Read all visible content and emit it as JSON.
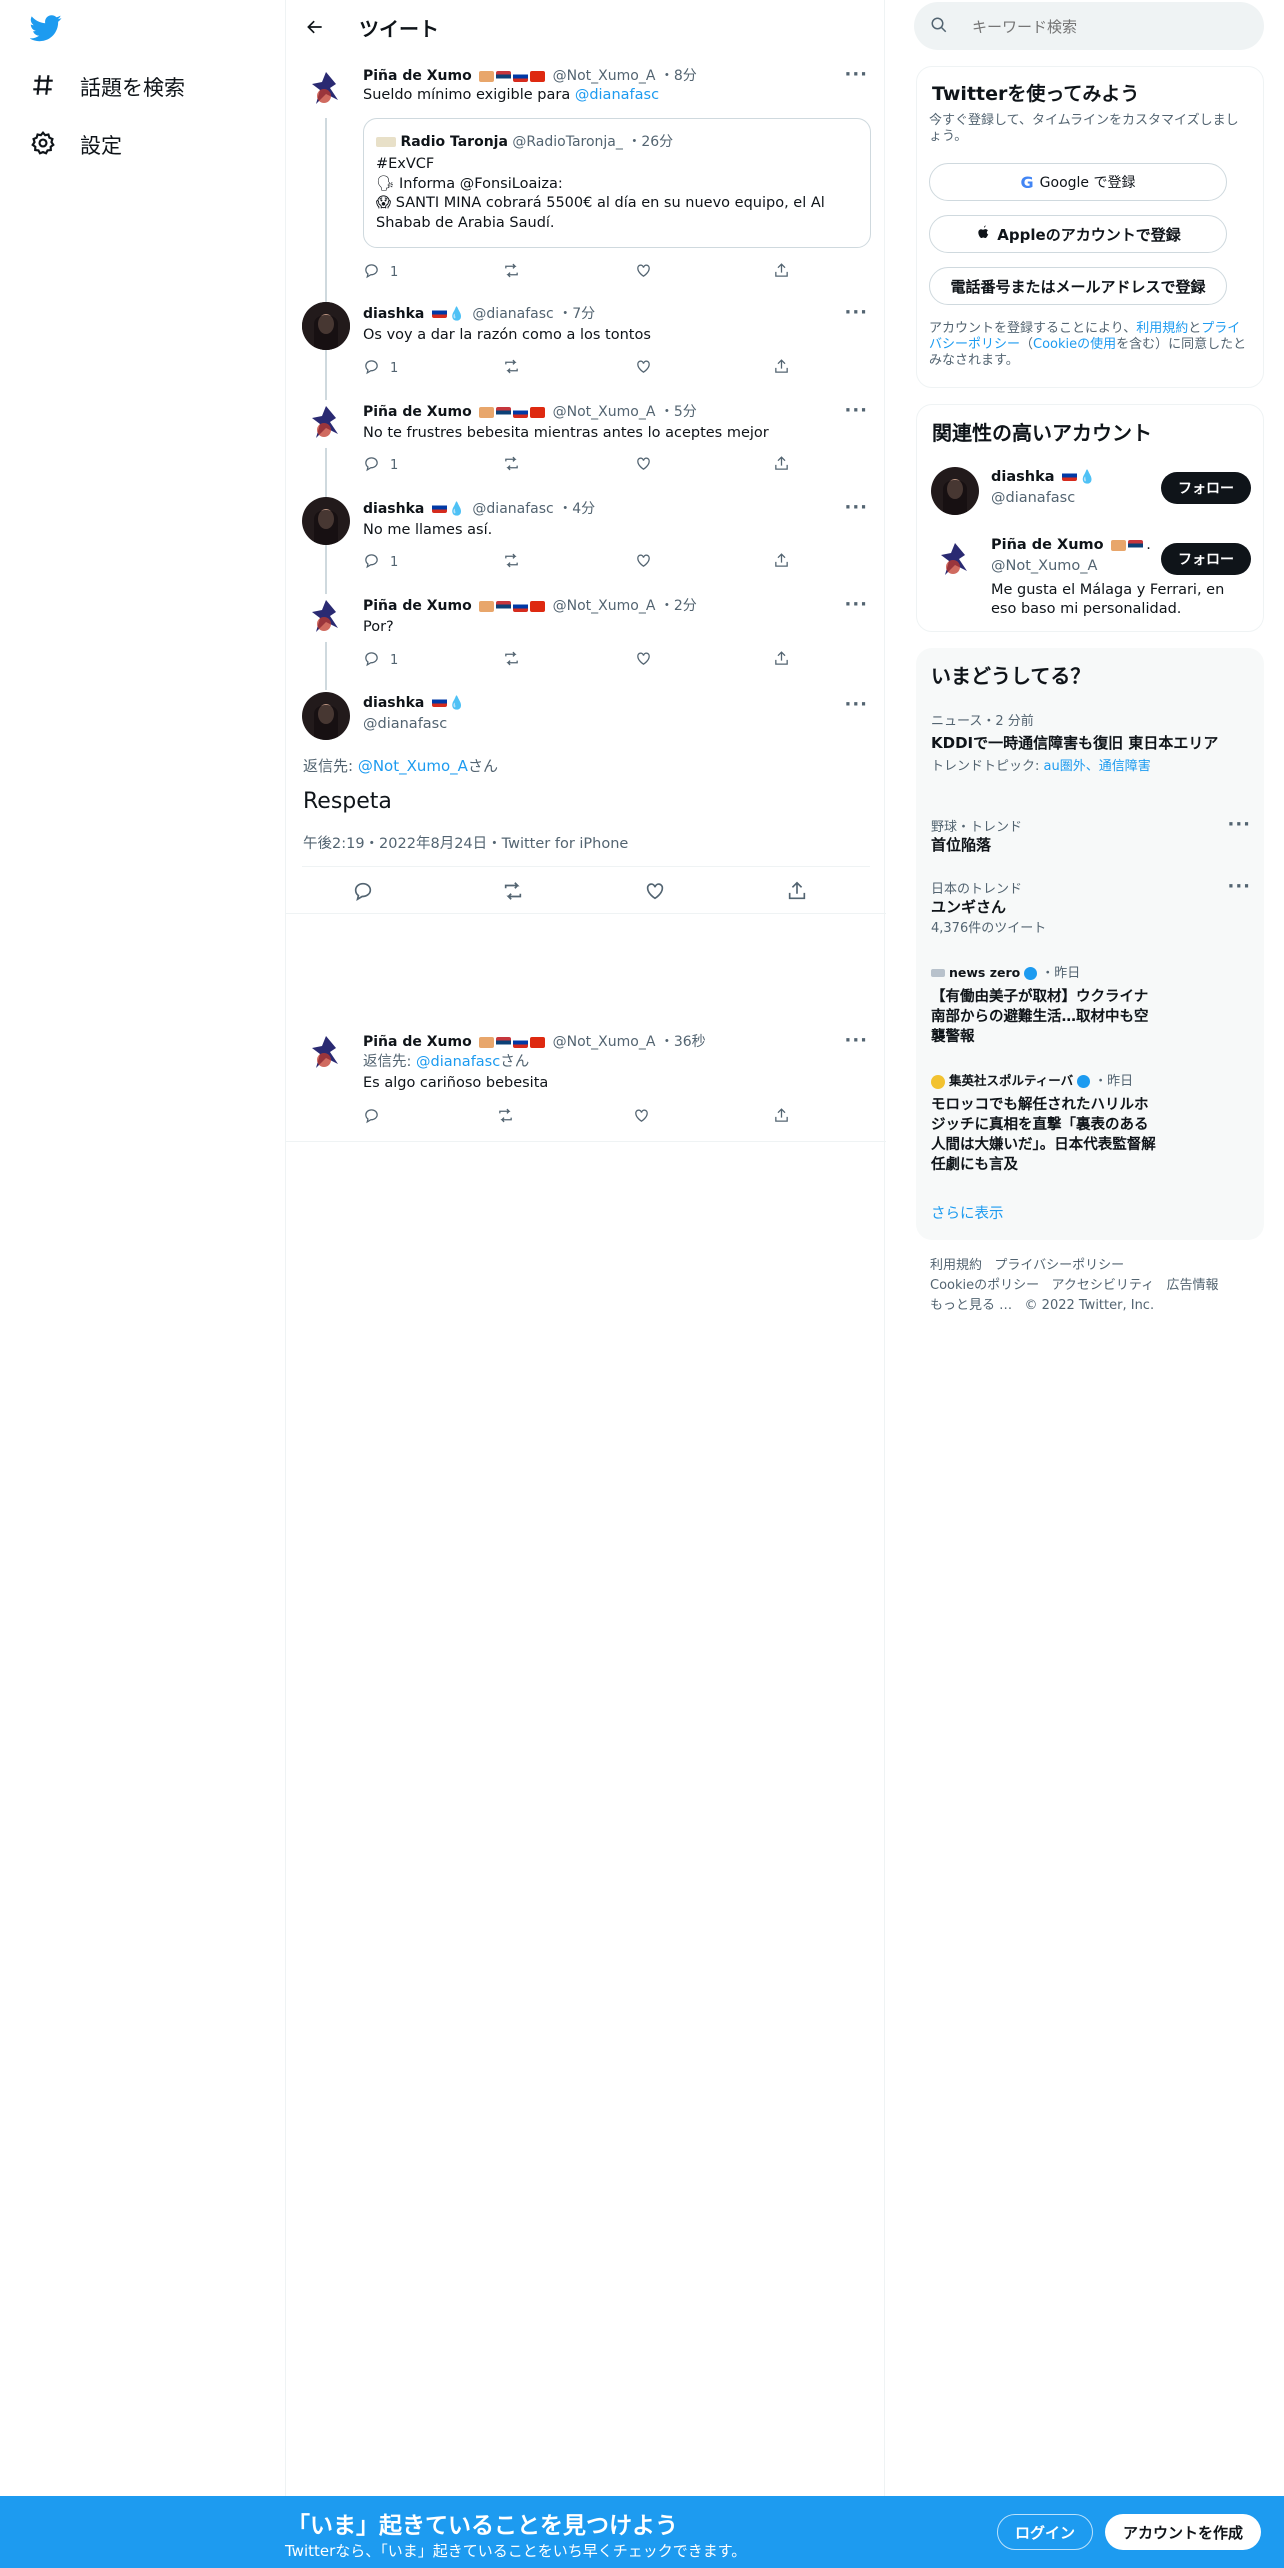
{
  "nav": {
    "logo_icon": "twitter-bird-icon",
    "items": [
      {
        "label": "話題を検索",
        "icon": "hashtag-icon"
      },
      {
        "label": "設定",
        "icon": "gear-icon"
      }
    ]
  },
  "header": {
    "title": "ツイート"
  },
  "colors": {
    "accent": "#1d9bf0",
    "text": "#0f1419",
    "muted": "#536471",
    "border": "#eff3f4"
  },
  "thread": [
    {
      "name": "Piña de Xumo",
      "handle": "@Not_Xumo_A",
      "time": "8分",
      "text": "Sueldo mínimo exigible para ",
      "mention": "@dianafasc",
      "reply_count": "1",
      "quote": {
        "name": "Radio Taronja",
        "handle": "@RadioTaronja_",
        "time": "26分",
        "lines": [
          "#ExVCF",
          "Informa @FonsiLoaiza:",
          "SANTI MINA cobrará 5500€ al día en su nuevo equipo, el Al",
          "Shabab de Arabia Saudí."
        ]
      }
    },
    {
      "name": "diashka",
      "handle": "@dianafasc",
      "time": "7分",
      "text": "Os voy a dar la razón como a los tontos",
      "reply_count": "1"
    },
    {
      "name": "Piña de Xumo",
      "handle": "@Not_Xumo_A",
      "time": "5分",
      "text": "No te frustres bebesita mientras antes lo aceptes mejor",
      "reply_count": "1"
    },
    {
      "name": "diashka",
      "handle": "@dianafasc",
      "time": "4分",
      "text": "No me llames así.",
      "reply_count": "1"
    },
    {
      "name": "Piña de Xumo",
      "handle": "@Not_Xumo_A",
      "time": "2分",
      "text": "Por?",
      "reply_count": "1"
    }
  ],
  "main_tweet": {
    "name": "diashka",
    "handle": "@dianafasc",
    "reply_prefix": "返信先: ",
    "reply_to": "@Not_Xumo_A",
    "reply_suffix": "さん",
    "text": "Respeta",
    "meta": "午後2:19・2022年8月24日・Twitter for iPhone"
  },
  "reply": {
    "name": "Piña de Xumo",
    "handle": "@Not_Xumo_A",
    "time": "36秒",
    "reply_prefix": "返信先: ",
    "reply_to": "@dianafasc",
    "reply_suffix": "さん",
    "text": "Es algo cariñoso bebesita"
  },
  "search": {
    "placeholder": "キーワード検索"
  },
  "signup_card": {
    "title": "Twitterを使ってみよう",
    "subtitle": "今すぐ登録して、タイムラインをカスタマイズしましょう。",
    "google": "Google で登録",
    "apple": "Appleのアカウントで登録",
    "phone": "電話番号またはメールアドレスで登録",
    "terms_pre": "アカウントを登録することにより、",
    "terms_link1": "利用規約",
    "terms_and": "と",
    "terms_link2": "プライバシーポリシー",
    "terms_paren_open": "（",
    "terms_link3": "Cookieの使用",
    "terms_post": "を含む）に同意したとみなされます。"
  },
  "related": {
    "title": "関連性の高いアカウント",
    "accounts": [
      {
        "name": "diashka",
        "handle": "@dianafasc",
        "bio": "",
        "follow": "フォロー"
      },
      {
        "name": "Piña de Xumo",
        "handle": "@Not_Xumo_A",
        "bio": "Me gusta el Málaga y Ferrari, en eso baso mi personalidad.",
        "follow": "フォロー"
      }
    ]
  },
  "trends": {
    "title": "いまどうしてる？",
    "items": [
      {
        "category": "ニュース・2 分前",
        "name": "KDDIで一時通信障害も復旧 東日本エリア",
        "extra_prefix": "トレンドトピック: ",
        "extra_links": "au圏外、通信障害"
      },
      {
        "category": "野球・トレンド",
        "name": "首位陥落"
      },
      {
        "category": "日本のトレンド",
        "name": "ユンギさん",
        "count": "4,376件のツイート"
      },
      {
        "source": "news zero",
        "time": "昨日",
        "name": "【有働由美子が取材】ウクライナ南部からの避難生活…取材中も空襲警報"
      },
      {
        "source": "集英社スポルティーバ",
        "time": "昨日",
        "name": "モロッコでも解任されたハリルホジッチに真相を直撃「裏表のある人間は大嫌いだ」。日本代表監督解任劇にも言及"
      }
    ],
    "show_more": "さらに表示"
  },
  "footer": {
    "links": [
      "利用規約",
      "プライバシーポリシー",
      "Cookieのポリシー",
      "アクセシビリティ",
      "広告情報",
      "もっと見る …"
    ],
    "copyright": "© 2022 Twitter, Inc."
  },
  "banner": {
    "title": "「いま」起きていることを見つけよう",
    "subtitle": "Twitterなら、「いま」起きていることをいち早くチェックできます。",
    "login": "ログイン",
    "signup": "アカウントを作成"
  }
}
